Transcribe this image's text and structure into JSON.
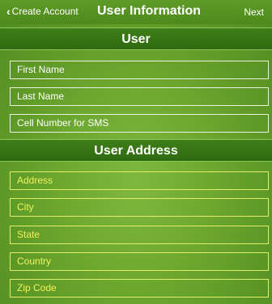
{
  "navbar": {
    "back_label": "Create Account",
    "title": "User Information",
    "next_label": "Next"
  },
  "sections": [
    {
      "title": "User",
      "fields": [
        "First Name",
        "Last Name",
        "Cell Number for SMS"
      ]
    },
    {
      "title": "User Address",
      "fields": [
        "Address",
        "City",
        "State",
        "Country",
        "Zip Code"
      ]
    }
  ],
  "colors": {
    "background": "#6aa52e",
    "header": "#3f7e18",
    "text_white": "#ffffff",
    "text_yellow": "#f2f25a"
  },
  "icons": {
    "back": "chevron-left-icon"
  }
}
